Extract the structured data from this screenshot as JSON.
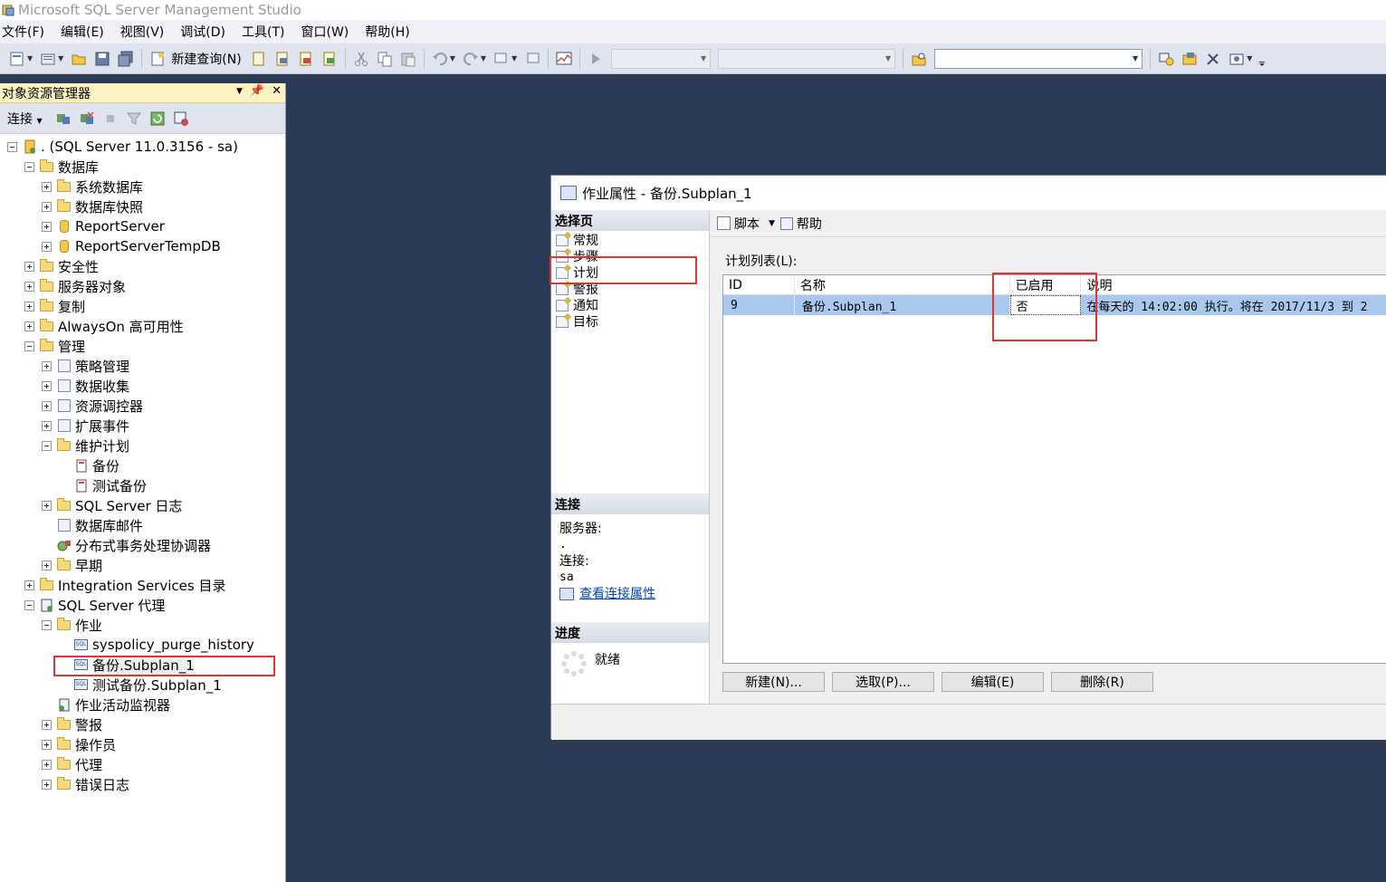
{
  "window": {
    "title": "Microsoft SQL Server Management Studio"
  },
  "menu": [
    "文件(F)",
    "编辑(E)",
    "视图(V)",
    "调试(D)",
    "工具(T)",
    "窗口(W)",
    "帮助(H)"
  ],
  "toolbar": {
    "new_query_label": "新建查询(N)"
  },
  "object_explorer": {
    "title": "对象资源管理器",
    "connect_label": "连接",
    "tree": {
      "server": ". (SQL Server 11.0.3156 - sa)",
      "databases": "数据库",
      "system_databases": "系统数据库",
      "db_snapshots": "数据库快照",
      "report_server": "ReportServer",
      "report_server_temp": "ReportServerTempDB",
      "security": "安全性",
      "server_objects": "服务器对象",
      "replication": "复制",
      "alwayson": "AlwaysOn 高可用性",
      "management": "管理",
      "policy_mgmt": "策略管理",
      "data_collection": "数据收集",
      "resource_governor": "资源调控器",
      "extended_events": "扩展事件",
      "maintenance_plans": "维护计划",
      "plan_backup": "备份",
      "plan_test_backup": "测试备份",
      "sql_server_logs": "SQL Server 日志",
      "db_mail": "数据库邮件",
      "dtc": "分布式事务处理协调器",
      "legacy": "早期",
      "integration_services": "Integration Services 目录",
      "sql_agent": "SQL Server 代理",
      "jobs": "作业",
      "job_syspolicy": "syspolicy_purge_history",
      "job_backup": "备份.Subplan_1",
      "job_test_backup": "测试备份.Subplan_1",
      "job_activity_monitor": "作业活动监视器",
      "alerts": "警报",
      "operators": "操作员",
      "proxies": "代理",
      "error_logs": "错误日志"
    }
  },
  "dialog": {
    "title": "作业属性 - 备份.Subplan_1",
    "select_page_header": "选择页",
    "pages": [
      "常规",
      "步骤",
      "计划",
      "警报",
      "通知",
      "目标"
    ],
    "connection_header": "连接",
    "server_label": "服务器:",
    "server_value": ".",
    "connection_label": "连接:",
    "connection_value": "sa",
    "view_connection_props": "查看连接属性",
    "progress_header": "进度",
    "progress_status": "就绪",
    "script_label": "脚本",
    "help_label": "帮助",
    "schedule_list_label": "计划列表(L):",
    "grid": {
      "columns": [
        "ID",
        "名称",
        "已启用",
        "说明"
      ],
      "rows": [
        {
          "id": "9",
          "name": "备份.Subplan_1",
          "enabled": "否",
          "description": "在每天的 14:02:00 执行。将在 2017/11/3 到 2"
        }
      ]
    },
    "buttons": {
      "new": "新建(N)...",
      "pick": "选取(P)...",
      "edit": "编辑(E)",
      "delete": "删除(R)"
    }
  }
}
